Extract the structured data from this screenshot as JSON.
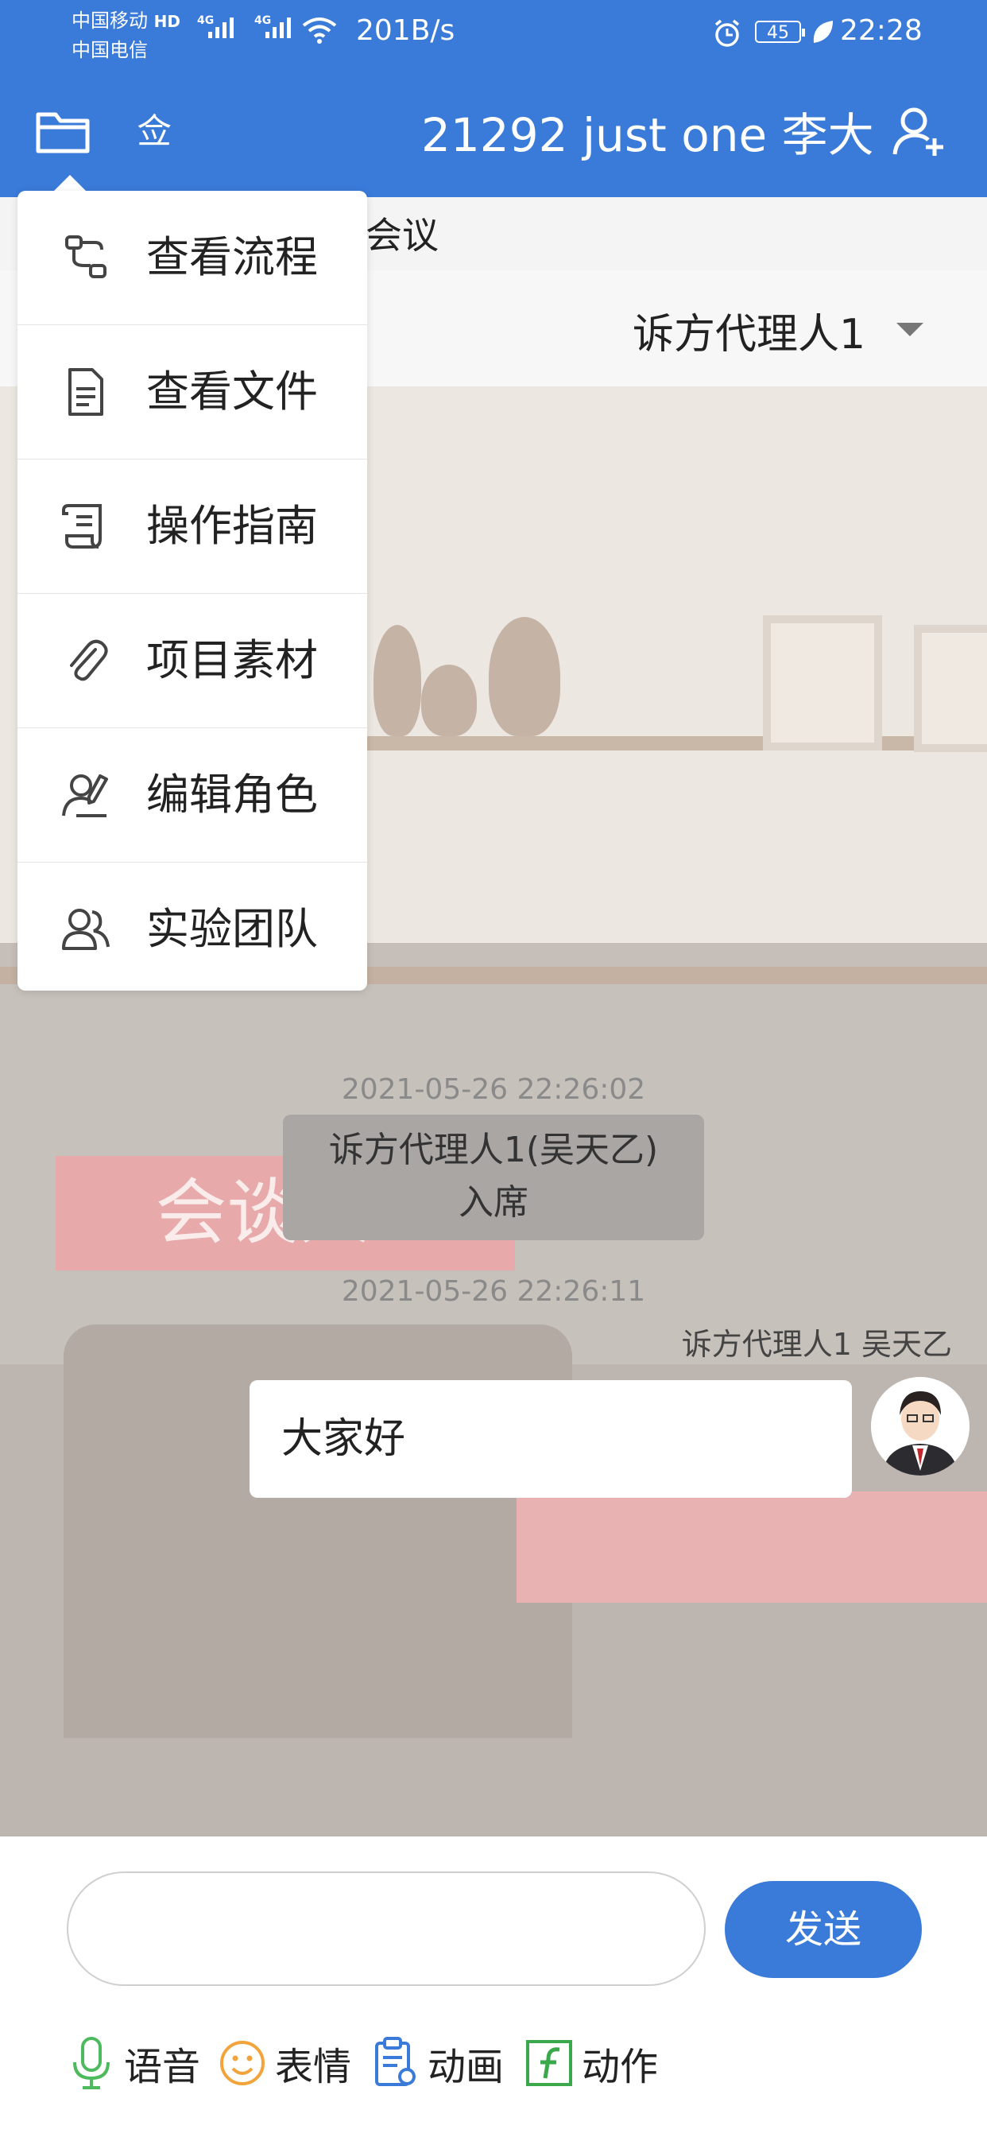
{
  "status_bar": {
    "carrier1": "中国移动",
    "carrier1_badge": "HD",
    "carrier2": "中国电信",
    "network_type": "4G",
    "net_speed": "201B/s",
    "battery": "45",
    "time": "22:28"
  },
  "header": {
    "dict_glyph": "佥",
    "title": "21292 just one 李大"
  },
  "subtitle": "会议",
  "role_selector": {
    "value": "诉方代理人1"
  },
  "menu": {
    "items": [
      {
        "label": "查看流程",
        "icon": "flow-icon"
      },
      {
        "label": "查看文件",
        "icon": "document-icon"
      },
      {
        "label": "操作指南",
        "icon": "scroll-guide-icon"
      },
      {
        "label": "项目素材",
        "icon": "paperclip-icon"
      },
      {
        "label": "编辑角色",
        "icon": "edit-role-icon"
      },
      {
        "label": "实验团队",
        "icon": "team-icon"
      }
    ]
  },
  "scene": {
    "nameplate": "会谈人2"
  },
  "chat": {
    "messages": [
      {
        "timestamp": "2021-05-26 22:26:02",
        "system_line1": "诉方代理人1(吴天乙)",
        "system_line2": "入席"
      },
      {
        "timestamp": "2021-05-26 22:26:11",
        "sender": "诉方代理人1  吴天乙",
        "text": "大家好"
      }
    ]
  },
  "input": {
    "placeholder": "",
    "send_label": "发送"
  },
  "toolbar": {
    "voice_label": "语音",
    "emoji_label": "表情",
    "animation_label": "动画",
    "action_label": "动作"
  },
  "colors": {
    "primary": "#3a7ad8",
    "voice": "#4cba5d",
    "emoji": "#f2a33a",
    "anim": "#3a7ad8",
    "action": "#3aa84b"
  }
}
